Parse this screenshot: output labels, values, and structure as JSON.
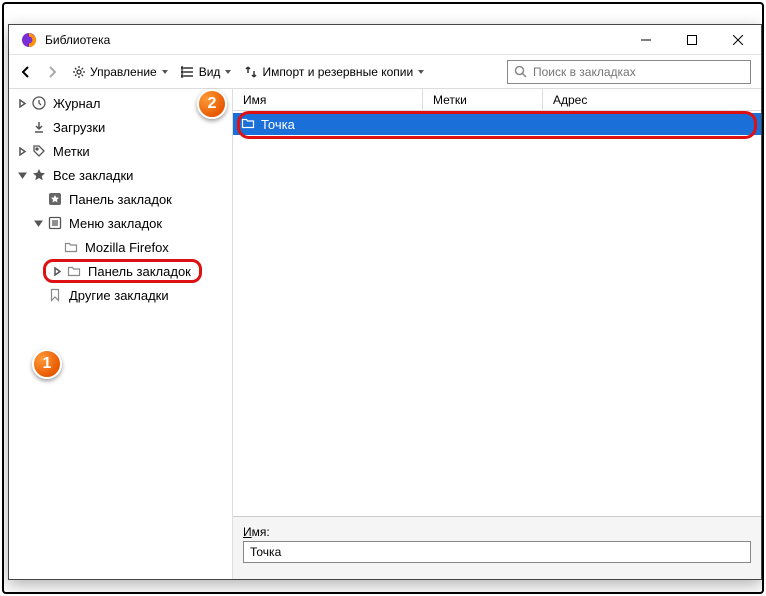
{
  "window": {
    "title": "Библиотека"
  },
  "sys": {
    "min": "minimize",
    "max": "maximize",
    "close": "close"
  },
  "toolbar": {
    "manage": "Управление",
    "view": "Вид",
    "import": "Импорт и резервные копии"
  },
  "search": {
    "placeholder": "Поиск в закладках"
  },
  "tree": {
    "history": "Журнал",
    "downloads": "Загрузки",
    "tags": "Метки",
    "all": "Все закладки",
    "toolbar": "Панель закладок",
    "menu": "Меню закладок",
    "mozilla": "Mozilla Firefox",
    "toolbar2": "Панель закладок",
    "other": "Другие закладки"
  },
  "columns": {
    "name": "Имя",
    "tags": "Метки",
    "address": "Адрес"
  },
  "row": {
    "name": "Точка"
  },
  "details": {
    "label_letter": "И",
    "label_rest": "мя:",
    "value": "Точка"
  },
  "badges": {
    "one": "1",
    "two": "2"
  }
}
